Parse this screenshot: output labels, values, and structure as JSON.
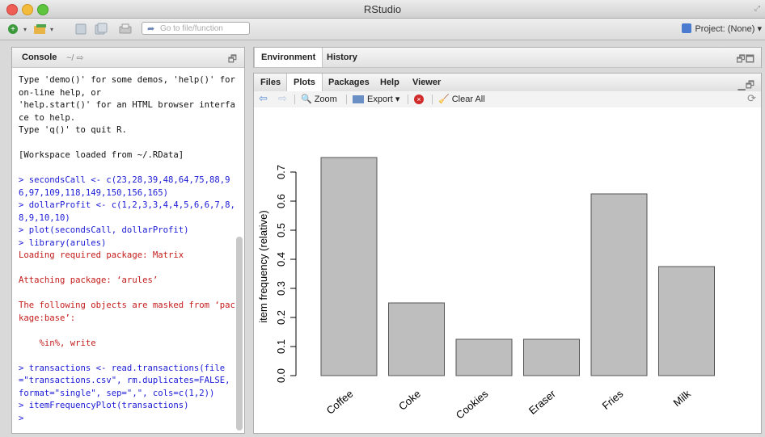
{
  "window": {
    "title": "RStudio"
  },
  "toolbar": {
    "goto_placeholder": "Go to file/function",
    "project_label": "Project: (None)"
  },
  "console": {
    "title": "Console",
    "path": "~/",
    "lines": [
      {
        "t": "out",
        "text": "Type 'demo()' for some demos, 'help()' for on-line help, or"
      },
      {
        "t": "out",
        "text": "'help.start()' for an HTML browser interface to help."
      },
      {
        "t": "out",
        "text": "Type 'q()' to quit R."
      },
      {
        "t": "out",
        "text": ""
      },
      {
        "t": "out",
        "text": "[Workspace loaded from ~/.RData]"
      },
      {
        "t": "out",
        "text": ""
      },
      {
        "t": "in",
        "text": "> secondsCall <- c(23,28,39,48,64,75,88,96,97,109,118,149,150,156,165)"
      },
      {
        "t": "in",
        "text": "> dollarProfit <- c(1,2,3,3,4,4,5,6,6,7,8,8,9,10,10)"
      },
      {
        "t": "in",
        "text": "> plot(secondsCall, dollarProfit)"
      },
      {
        "t": "in",
        "text": "> library(arules)"
      },
      {
        "t": "err",
        "text": "Loading required package: Matrix"
      },
      {
        "t": "err",
        "text": ""
      },
      {
        "t": "err",
        "text": "Attaching package: ‘arules’"
      },
      {
        "t": "err",
        "text": ""
      },
      {
        "t": "err",
        "text": "The following objects are masked from ‘package:base’:"
      },
      {
        "t": "err",
        "text": ""
      },
      {
        "t": "err",
        "text": "    %in%, write"
      },
      {
        "t": "err",
        "text": ""
      },
      {
        "t": "in",
        "text": "> transactions <- read.transactions(file=\"transactions.csv\", rm.duplicates=FALSE, format=\"single\", sep=\",\", cols=c(1,2))"
      },
      {
        "t": "in",
        "text": "> itemFrequencyPlot(transactions)"
      },
      {
        "t": "in",
        "text": ">"
      }
    ]
  },
  "env_pane": {
    "tabs": [
      "Environment",
      "History"
    ]
  },
  "files_pane": {
    "tabs": [
      "Files",
      "Plots",
      "Packages",
      "Help",
      "Viewer"
    ],
    "active_tab": "Plots",
    "tools": {
      "zoom": "Zoom",
      "export": "Export",
      "clear": "Clear All"
    }
  },
  "colors": {
    "bar_fill": "#bebebe",
    "bar_stroke": "#555555",
    "input": "#1a1ad6",
    "error": "#c41a1a"
  },
  "chart_data": {
    "type": "bar",
    "categories": [
      "Coffee",
      "Coke",
      "Cookies",
      "Eraser",
      "Fries",
      "Milk"
    ],
    "values": [
      0.75,
      0.25,
      0.125,
      0.125,
      0.625,
      0.375
    ],
    "ylabel": "item frequency (relative)",
    "yticks": [
      "0.0",
      "0.1",
      "0.2",
      "0.3",
      "0.4",
      "0.5",
      "0.6",
      "0.7"
    ],
    "ylim": [
      0,
      0.75
    ],
    "grid": false
  }
}
